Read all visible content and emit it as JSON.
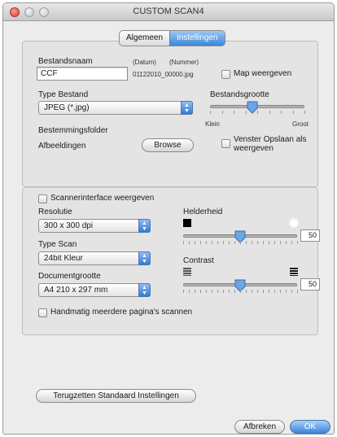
{
  "window": {
    "title": "CUSTOM SCAN4"
  },
  "tabs": [
    {
      "label": "Algemeen",
      "selected": false
    },
    {
      "label": "Instellingen",
      "selected": true
    }
  ],
  "file": {
    "name_label": "Bestandsnaam",
    "date_token": "(Datum)",
    "number_token": "(Nummer)",
    "name_value": "CCF",
    "name_example": "01122010_00000.jpg",
    "map_checkbox_label": "Map weergeven",
    "map_checked": false,
    "type_label": "Type Bestand",
    "type_value": "JPEG (*.jpg)",
    "size_label": "Bestandsgrootte",
    "size_min_label": "Klein",
    "size_max_label": "Groot",
    "size_level_fraction": 0.45,
    "dest_label": "Bestemmingsfolder",
    "dest_value": "Afbeeldingen",
    "browse_label": "Browse",
    "save_window_label_1": "Venster Opslaan als",
    "save_window_label_2": "weergeven",
    "save_window_checked": false
  },
  "scan": {
    "interface_label": "Scannerinterface weergeven",
    "interface_checked": false,
    "resolution_label": "Resolutie",
    "resolution_value": "300 x 300 dpi",
    "scan_type_label": "Type Scan",
    "scan_type_value": "24bit Kleur",
    "doc_size_label": "Documentgrootte",
    "doc_size_value": "A4  210 x 297 mm",
    "brightness_label": "Helderheid",
    "brightness_value": "50",
    "contrast_label": "Contrast",
    "contrast_value": "50",
    "multi_page_label": "Handmatig meerdere pagina's scannen",
    "multi_page_checked": false
  },
  "footer": {
    "reset_label": "Terugzetten Standaard Instellingen",
    "cancel_label": "Afbreken",
    "ok_label": "OK"
  },
  "colors": {
    "accent": "#3b86dd",
    "window_bg": "#ececec"
  }
}
